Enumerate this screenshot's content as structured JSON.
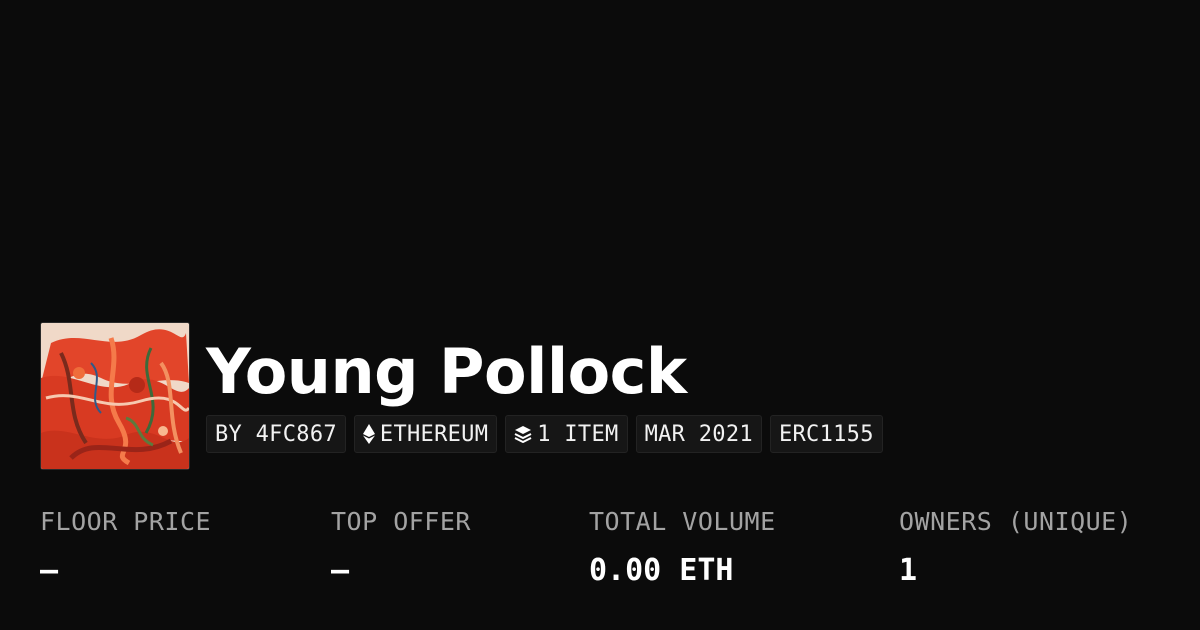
{
  "collection": {
    "name": "Young Pollock",
    "image_icon": "abstract-painting-thumbnail"
  },
  "chips": [
    {
      "label": "BY 4FC867"
    },
    {
      "label": "ETHEREUM",
      "icon": "ethereum-icon"
    },
    {
      "label": "1 ITEM",
      "icon": "layers-icon"
    },
    {
      "label": "MAR 2021"
    },
    {
      "label": "ERC1155"
    }
  ],
  "stats": [
    {
      "label": "FLOOR PRICE",
      "value": "–"
    },
    {
      "label": "TOP OFFER",
      "value": "–"
    },
    {
      "label": "TOTAL VOLUME",
      "value": "0.00 ETH"
    },
    {
      "label": "OWNERS (UNIQUE)",
      "value": "1"
    }
  ],
  "colors": {
    "background": "#0b0b0b",
    "chip_background": "#161616",
    "label": "#a3a3a3",
    "text": "#ffffff"
  }
}
